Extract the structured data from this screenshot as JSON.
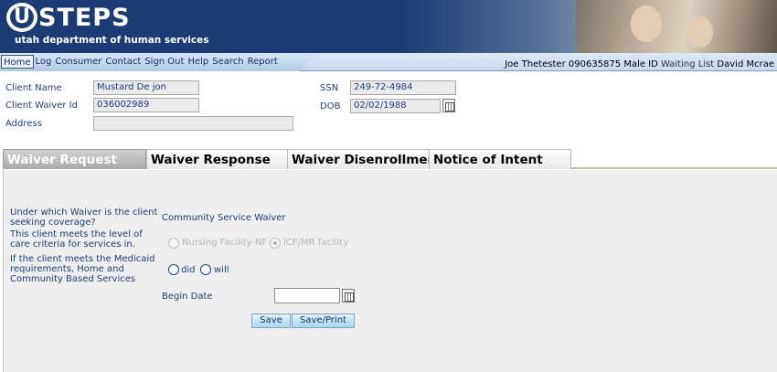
{
  "header": {
    "logo_letter": "U",
    "logo_rest": "STEPS",
    "subtitle": "utah department of human services"
  },
  "nav": {
    "items": [
      "Home",
      "Log",
      "Consumer",
      "Contact",
      "Sign Out",
      "Help",
      "Search",
      "Report"
    ],
    "active": "Home"
  },
  "user_info": {
    "text": "Joe Thetester 090635875 Male ID",
    "waiting": "Waiting List",
    "name": "David Mcrae"
  },
  "client": {
    "name_label": "Client Name",
    "name_value": "Mustard De jon",
    "waiver_id_label": "Client Waiver Id",
    "waiver_id_value": "036002989",
    "address_label": "Address",
    "address_value": "",
    "ssn_label": "SSN",
    "ssn_value": "249-72-4984",
    "dob_label": "DOB",
    "dob_value": "02/02/1988"
  },
  "tabs": [
    "Waiver Request",
    "Waiver Response",
    "Waiver Disenrollment",
    "Notice of Intent"
  ],
  "active_tab": "Waiver Request",
  "form": {
    "q_waiver": "Under which Waiver is the client seeking coverage?",
    "waiver_value": "Community Service Waiver",
    "q_care": "This client meets the level of care criteria for services in.",
    "care_options": [
      "Nursing Facility-NF",
      "ICF/MR facility"
    ],
    "care_selected": "ICF/MR facility",
    "q_medicaid": "If the client meets the Medicaid requirements, Home and Community Based Services",
    "medicaid_options": [
      "did",
      "will"
    ],
    "begin_date_label": "Begin Date",
    "begin_date_value": "",
    "save_label": "Save",
    "save_print_label": "Save/Print"
  },
  "colors": {
    "banner": "#1a3c72",
    "label_text": "#1f3f73",
    "button_fill": "#a9d6ef",
    "panel_bg": "#eeeeee"
  }
}
